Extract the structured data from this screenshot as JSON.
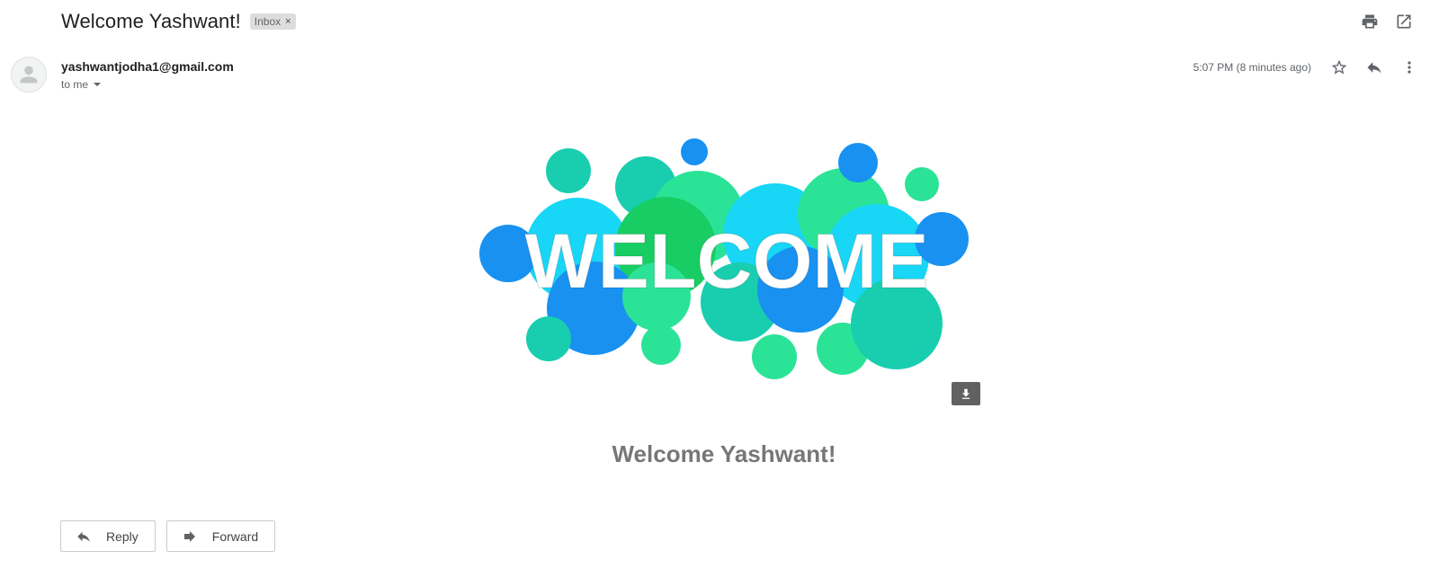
{
  "email": {
    "subject": "Welcome Yashwant!",
    "label": "Inbox",
    "label_remove": "×",
    "sender": "yashwantjodha1@gmail.com",
    "recipient": "to me",
    "timestamp": "5:07 PM (8 minutes ago)"
  },
  "banner": {
    "word": "WELCOME",
    "colors": [
      "#0086f0",
      "#00c9a7",
      "#00d2f5",
      "#00c853",
      "#14e08c"
    ]
  },
  "body": {
    "heading": "Welcome Yashwant!"
  },
  "actions": {
    "reply_label": "Reply",
    "forward_label": "Forward"
  },
  "icons": [
    "print-icon",
    "open-in-new-window-icon",
    "star-icon",
    "reply-icon",
    "more-vert-icon",
    "download-icon",
    "avatar-icon"
  ]
}
